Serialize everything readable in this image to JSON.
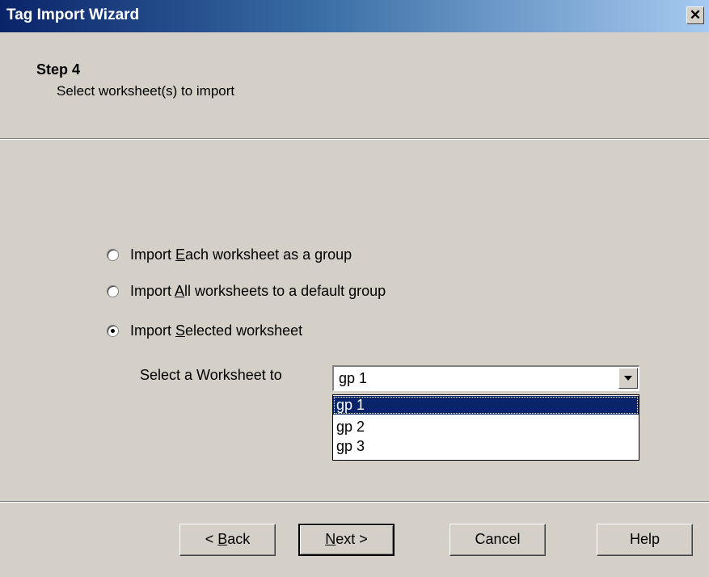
{
  "window": {
    "title": "Tag Import Wizard",
    "close_glyph": "✕"
  },
  "header": {
    "step_title": "Step 4",
    "step_subtitle": "Select worksheet(s) to import"
  },
  "options": [
    {
      "pre": "Import ",
      "key": "E",
      "post": "ach worksheet as a group",
      "checked": false
    },
    {
      "pre": "Import ",
      "key": "A",
      "post": "ll worksheets to a default group",
      "checked": false
    },
    {
      "pre": "Import ",
      "key": "S",
      "post": "elected worksheet",
      "checked": true
    }
  ],
  "worksheet": {
    "label": "Select a Worksheet to",
    "selected": "gp 1",
    "items": [
      "gp 1",
      "gp 2",
      "gp 3"
    ]
  },
  "buttons": {
    "back": {
      "pre": "< ",
      "key": "B",
      "post": "ack"
    },
    "next": {
      "pre": "",
      "key": "N",
      "post": "ext >"
    },
    "cancel": "Cancel",
    "help": "Help"
  }
}
